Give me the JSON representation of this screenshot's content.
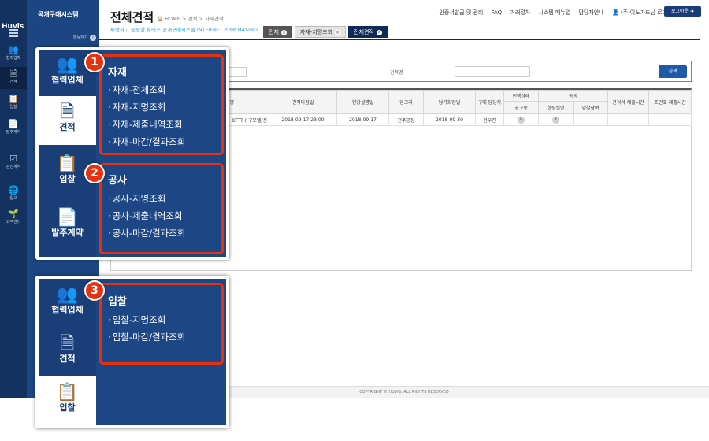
{
  "rail": {
    "brand": "Huvis",
    "items": [
      {
        "icon": "users-icon",
        "glyph": "👥",
        "label": "협력업체"
      },
      {
        "icon": "document-icon",
        "glyph": "🗎",
        "label": "견적"
      },
      {
        "icon": "clipboard-icon",
        "glyph": "📋",
        "label": "입찰"
      },
      {
        "icon": "contract-icon",
        "glyph": "📄",
        "label": "발주계약"
      },
      {
        "icon": "checklist-icon",
        "glyph": "☑",
        "label": "검진계약"
      },
      {
        "icon": "globe-icon",
        "glyph": "🌐",
        "label": "입고"
      },
      {
        "icon": "plant-icon",
        "glyph": "🌱",
        "label": "고객센터"
      }
    ]
  },
  "sidebar": {
    "title": "공개구매시스템",
    "toggle_label": "메뉴닫기",
    "toggle_arrow": "‹"
  },
  "header": {
    "title": "전체견적",
    "breadcrumb": "🏠 HOME > 견적 > 자재견적",
    "subtitle": "투명하고 공정한 휴비스 공개구매시스템 INTERNET PURCHASING",
    "links": [
      "인증서발급 및 관리",
      "FAQ",
      "거래절차",
      "시스템 매뉴얼",
      "담당자안내",
      "👤 (주)이노가드님 로그인중"
    ],
    "logout": "로그아웃 ➜"
  },
  "tabs": [
    {
      "label": "전체",
      "close": "×"
    },
    {
      "label": "자재-지명조회",
      "close": "×"
    },
    {
      "label": "전체견적",
      "close": "×"
    }
  ],
  "search": {
    "label": "· 견적명",
    "button": "검색"
  },
  "table": {
    "headers": {
      "name": "명",
      "deadline": "견적마감일",
      "site_date": "현장설명일",
      "location": "입고지",
      "delivery": "납기희망일",
      "buyer": "구매 담당자",
      "progress": "진행상태",
      "notice": "공고중",
      "agree": "동의",
      "site": "현장설명",
      "bid_join": "입찰참여",
      "submit_time": "견적서 제출시간",
      "cond_time": "조건표 제출시간"
    },
    "row": {
      "name": "8TTT ( 구모델/신",
      "deadline": "2018-09-17 23:00",
      "site_date": "2018-09-17",
      "location": "전주공장",
      "delivery": "2018-09-30",
      "buyer": "현우진",
      "notice": "V",
      "site": "X"
    }
  },
  "footer": "COPYRIGHT © HUVIS. ALL RIGHTS RESERVED",
  "callouts": [
    {
      "badge": "1",
      "col_items": [
        {
          "icon": "users-icon",
          "glyph": "👥",
          "label": "협력업체"
        },
        {
          "icon": "document-icon",
          "glyph": "🗎",
          "label": "견적"
        },
        {
          "icon": "clipboard-icon",
          "glyph": "📋",
          "label": "입찰"
        },
        {
          "icon": "contract-icon",
          "glyph": "📄",
          "label": "발주계약"
        }
      ],
      "group_title": "자재",
      "items": [
        "자재-전체조회",
        "자재-지명조회",
        "자재-제출내역조회",
        "자재-마감/결과조회"
      ]
    },
    {
      "badge": "2",
      "group_title": "공사",
      "items": [
        "공사-지명조회",
        "공사-제출내역조회",
        "공사-마감/결과조회"
      ]
    },
    {
      "badge": "3",
      "col_items": [
        {
          "icon": "users-icon",
          "glyph": "👥",
          "label": "협력업체"
        },
        {
          "icon": "document-icon",
          "glyph": "🗎",
          "label": "견적"
        },
        {
          "icon": "clipboard-icon",
          "glyph": "📋",
          "label": "입찰"
        }
      ],
      "group_title": "입찰",
      "items": [
        "입찰-지명조회",
        "입찰-마감/결과조회"
      ]
    }
  ],
  "colors": {
    "rail_bg": "#14325f",
    "sidebar_bg": "#1c4682",
    "accent_blue": "#1f5aa8",
    "callout_red": "#e8320f",
    "subtitle_cyan": "#2e9fd8"
  }
}
